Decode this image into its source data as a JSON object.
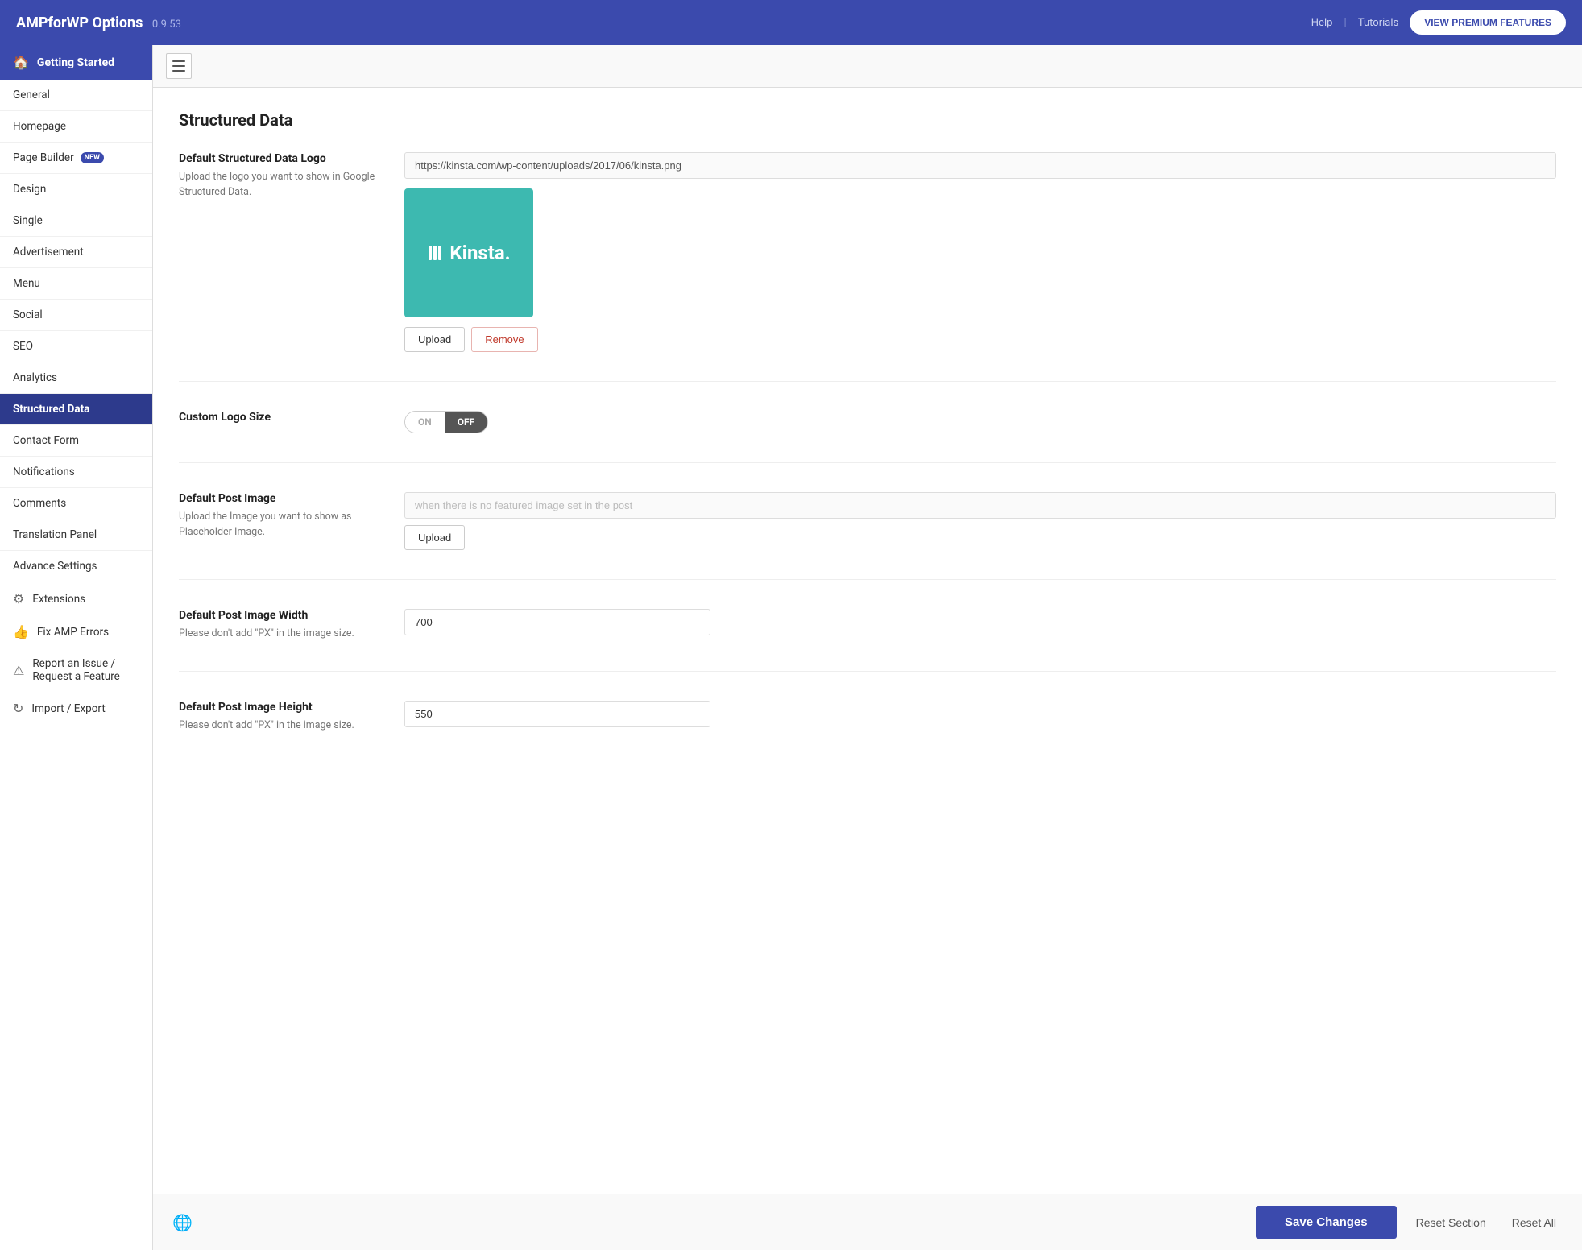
{
  "header": {
    "title": "AMPforWP Options",
    "version": "0.9.53",
    "help_label": "Help",
    "tutorials_label": "Tutorials",
    "premium_button": "VIEW PREMIUM FEATURES"
  },
  "sidebar": {
    "getting_started": "Getting Started",
    "items": [
      {
        "id": "general",
        "label": "General",
        "active": false
      },
      {
        "id": "homepage",
        "label": "Homepage",
        "active": false
      },
      {
        "id": "page-builder",
        "label": "Page Builder",
        "badge": "NEW",
        "active": false
      },
      {
        "id": "design",
        "label": "Design",
        "active": false
      },
      {
        "id": "single",
        "label": "Single",
        "active": false
      },
      {
        "id": "advertisement",
        "label": "Advertisement",
        "active": false
      },
      {
        "id": "menu",
        "label": "Menu",
        "active": false
      },
      {
        "id": "social",
        "label": "Social",
        "active": false
      },
      {
        "id": "seo",
        "label": "SEO",
        "active": false
      },
      {
        "id": "analytics",
        "label": "Analytics",
        "active": false
      },
      {
        "id": "structured-data",
        "label": "Structured Data",
        "active": true
      },
      {
        "id": "contact-form",
        "label": "Contact Form",
        "active": false
      },
      {
        "id": "notifications",
        "label": "Notifications",
        "active": false
      },
      {
        "id": "comments",
        "label": "Comments",
        "active": false
      },
      {
        "id": "translation-panel",
        "label": "Translation Panel",
        "active": false
      },
      {
        "id": "advance-settings",
        "label": "Advance Settings",
        "active": false
      }
    ],
    "section_items": [
      {
        "id": "extensions",
        "label": "Extensions",
        "icon": "⚙"
      },
      {
        "id": "fix-amp-errors",
        "label": "Fix AMP Errors",
        "icon": "👍"
      },
      {
        "id": "report-issue",
        "label": "Report an Issue / Request a Feature",
        "icon": "⚠"
      },
      {
        "id": "import-export",
        "label": "Import / Export",
        "icon": "↻"
      }
    ]
  },
  "page": {
    "title": "Structured Data",
    "sections": [
      {
        "id": "default-logo",
        "label": "Default Structured Data Logo",
        "description": "Upload the logo you want to show in Google Structured Data.",
        "logo_url": "https://kinsta.com/wp-content/uploads/2017/06/kinsta.png",
        "upload_label": "Upload",
        "remove_label": "Remove"
      },
      {
        "id": "custom-logo-size",
        "label": "Custom Logo Size",
        "toggle_on": "ON",
        "toggle_off": "OFF"
      },
      {
        "id": "default-post-image",
        "label": "Default Post Image",
        "description": "Upload the Image you want to show as Placeholder Image.",
        "placeholder": "when there is no featured image set in the post",
        "upload_label": "Upload"
      },
      {
        "id": "image-width",
        "label": "Default Post Image Width",
        "description": "Please don't add \"PX\" in the image size.",
        "value": "700"
      },
      {
        "id": "image-height",
        "label": "Default Post Image Height",
        "description": "Please don't add \"PX\" in the image size.",
        "value": "550"
      }
    ]
  },
  "footer": {
    "save_label": "Save Changes",
    "reset_section_label": "Reset Section",
    "reset_all_label": "Reset All"
  }
}
